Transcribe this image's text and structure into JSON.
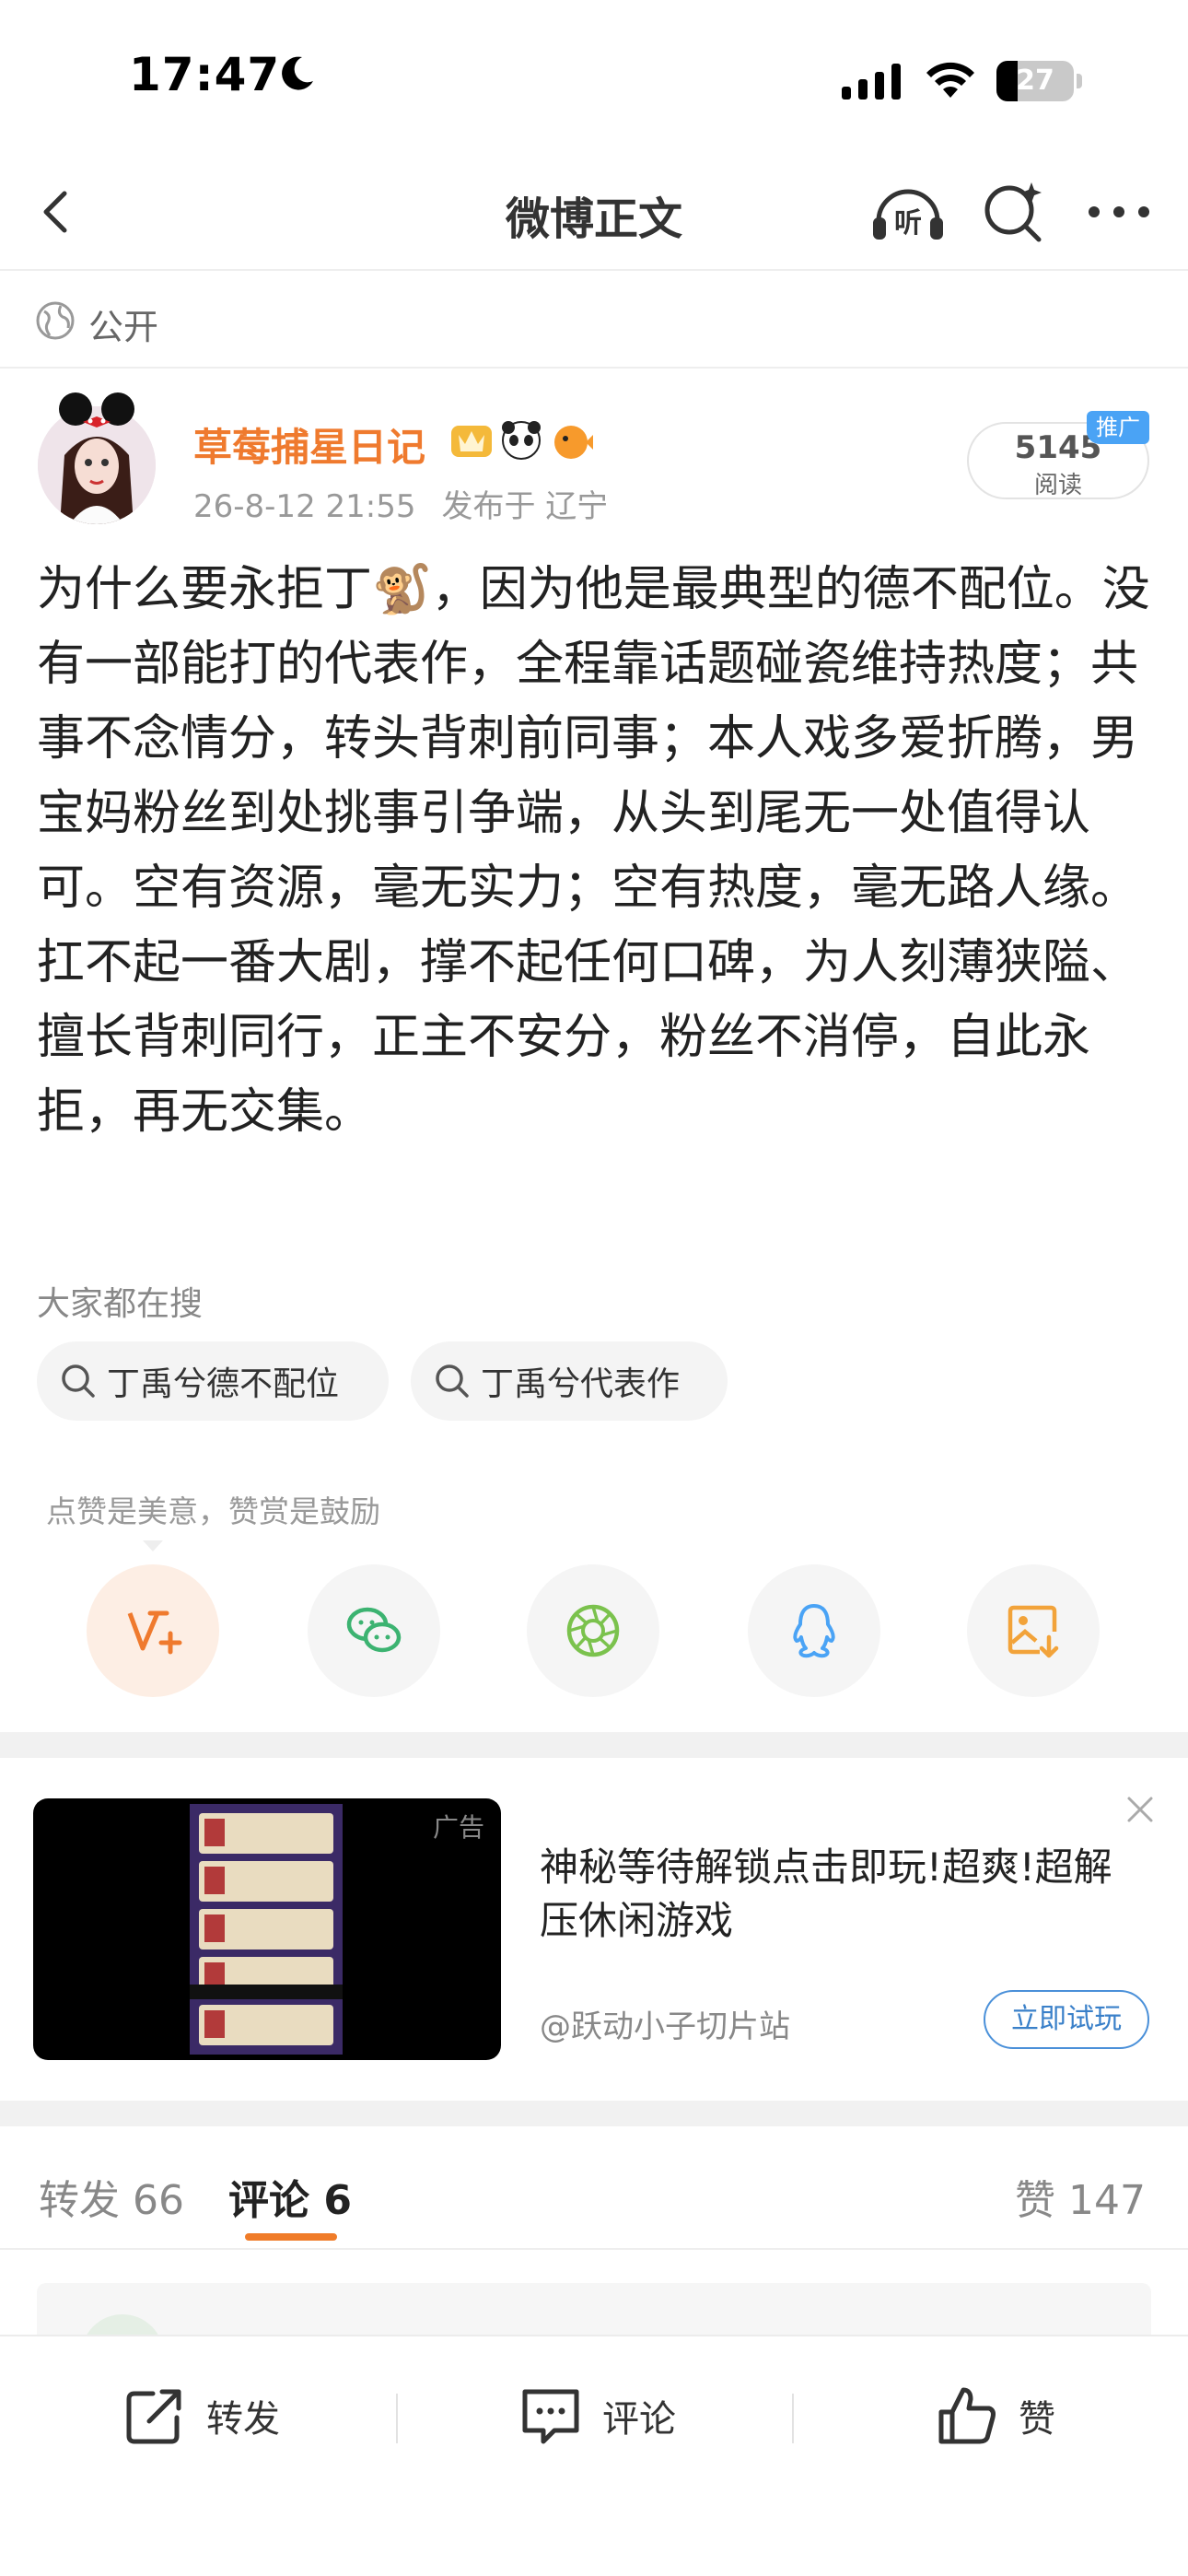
{
  "status_bar": {
    "time": "17:47",
    "battery": "27",
    "battery_level": 0.27
  },
  "nav": {
    "title": "微博正文"
  },
  "visibility": {
    "label": "公开"
  },
  "author": {
    "name": "草莓捕星日记",
    "date": "26-8-12 21:55",
    "location": "发布于 辽宁",
    "read_count": "5145",
    "read_label": "阅读",
    "promo_tag": "推广"
  },
  "post": {
    "text": "为什么要永拒丁🐒，因为他是最典型的德不配位。没有一部能打的代表作，全程靠话题碰瓷维持热度；共事不念情分，转头背刺前同事；本人戏多爱折腾，男宝妈粉丝到处挑事引争端，从头到尾无一处值得认可。空有资源，毫无实力；空有热度，毫无路人缘。扛不起一番大剧，撑不起任何口碑，为人刻薄狭隘、擅长背刺同行，正主不安分，粉丝不消停，自此永拒，再无交集。"
  },
  "trending": {
    "title": "大家都在搜",
    "chips": [
      "丁禹兮德不配位",
      "丁禹兮代表作"
    ]
  },
  "like_hint": "点赞是美意，赞赏是鼓励",
  "share_icons": [
    "reward-icon",
    "wechat-icon",
    "moments-icon",
    "qq-icon",
    "save-image-icon"
  ],
  "ad": {
    "label": "广告",
    "title": "神秘等待解锁点击即玩!超爽!超解压休闲游戏",
    "source": "@跃动小子切片站",
    "cta": "立即试玩"
  },
  "tabs": {
    "repost": "转发 66",
    "comment": "评论 6",
    "like": "赞 147"
  },
  "bottom_bar": {
    "repost": "转发",
    "comment": "评论",
    "like": "赞"
  },
  "colors": {
    "accent_orange": "#ef7a2e",
    "link_blue": "#3a80c9",
    "promo_blue": "#4aa3f5"
  }
}
